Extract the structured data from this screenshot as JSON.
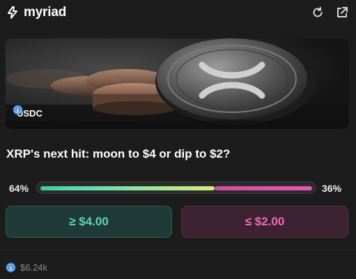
{
  "app": {
    "brand": "myriad"
  },
  "market": {
    "token_label": "USDC",
    "question": "XRP's next hit: moon to $4 or dip to $2?",
    "yes_percent_label": "64%",
    "no_percent_label": "36%",
    "yes_probability": 0.64,
    "no_probability": 0.36,
    "yes_outcome_label": "≥ $4.00",
    "no_outcome_label": "≤ $2.00",
    "volume": "$6.24k"
  },
  "colors": {
    "yes": "#5fd6b2",
    "no": "#ee6bbd",
    "usdc": "#2775ca",
    "background": "#1c1c1c"
  },
  "icons": {
    "logo": "myriad-bolt-icon",
    "refresh": "refresh-icon",
    "external": "external-link-icon",
    "token": "usdc-icon"
  }
}
